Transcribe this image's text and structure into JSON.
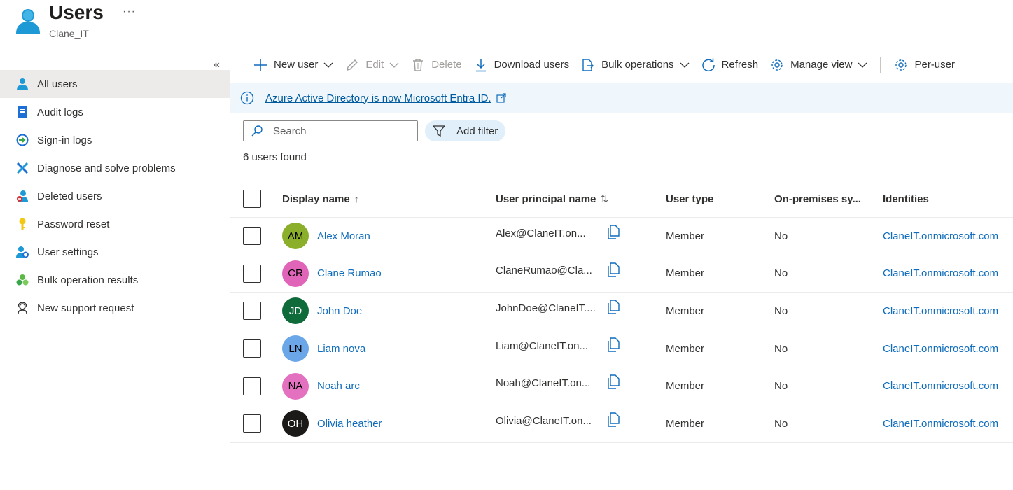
{
  "header": {
    "title": "Users",
    "subtitle": "Clane_IT",
    "more": "···"
  },
  "sidebar": {
    "collapse": "«",
    "items": [
      {
        "label": "All users",
        "icon": "user-icon",
        "active": true
      },
      {
        "label": "Audit logs",
        "icon": "audit-log-icon"
      },
      {
        "label": "Sign-in logs",
        "icon": "sign-in-icon"
      },
      {
        "label": "Diagnose and solve problems",
        "icon": "wrench-icon"
      },
      {
        "label": "Deleted users",
        "icon": "deleted-user-icon"
      },
      {
        "label": "Password reset",
        "icon": "key-icon"
      },
      {
        "label": "User settings",
        "icon": "user-settings-icon"
      },
      {
        "label": "Bulk operation results",
        "icon": "bulk-results-icon"
      },
      {
        "label": "New support request",
        "icon": "support-icon"
      }
    ]
  },
  "toolbar": {
    "new_user": "New user",
    "edit": "Edit",
    "delete": "Delete",
    "download": "Download users",
    "bulk": "Bulk operations",
    "refresh": "Refresh",
    "manage_view": "Manage view",
    "per_user": "Per-user"
  },
  "banner": {
    "text": "Azure Active Directory is now Microsoft Entra ID."
  },
  "search": {
    "placeholder": "Search"
  },
  "filter": {
    "label": "Add filter"
  },
  "count": "6 users found",
  "table": {
    "headers": {
      "display_name": "Display name",
      "display_name_sort": "↑",
      "upn": "User principal name",
      "upn_sort": "⇅",
      "user_type": "User type",
      "onprem": "On-premises sy...",
      "identities": "Identities"
    },
    "rows": [
      {
        "initials": "AM",
        "avatar_bg": "#8caf2b",
        "avatar_fg": "#000000",
        "name": "Alex Moran",
        "upn": "Alex@ClaneIT.on...",
        "type": "Member",
        "onprem": "No",
        "identity": "ClaneIT.onmicrosoft.com"
      },
      {
        "initials": "CR",
        "avatar_bg": "#e064b7",
        "avatar_fg": "#000000",
        "name": "Clane Rumao",
        "upn": "ClaneRumao@Cla...",
        "type": "Member",
        "onprem": "No",
        "identity": "ClaneIT.onmicrosoft.com"
      },
      {
        "initials": "JD",
        "avatar_bg": "#0f6b3a",
        "avatar_fg": "#ffffff",
        "name": "John Doe",
        "upn": "JohnDoe@ClaneIT....",
        "type": "Member",
        "onprem": "No",
        "identity": "ClaneIT.onmicrosoft.com"
      },
      {
        "initials": "LN",
        "avatar_bg": "#6ba7e8",
        "avatar_fg": "#000000",
        "name": "Liam nova",
        "upn": "Liam@ClaneIT.on...",
        "type": "Member",
        "onprem": "No",
        "identity": "ClaneIT.onmicrosoft.com"
      },
      {
        "initials": "NA",
        "avatar_bg": "#e371c0",
        "avatar_fg": "#000000",
        "name": "Noah arc",
        "upn": "Noah@ClaneIT.on...",
        "type": "Member",
        "onprem": "No",
        "identity": "ClaneIT.onmicrosoft.com"
      },
      {
        "initials": "OH",
        "avatar_bg": "#1b1a19",
        "avatar_fg": "#ffffff",
        "name": "Olivia heather",
        "upn": "Olivia@ClaneIT.on...",
        "type": "Member",
        "onprem": "No",
        "identity": "ClaneIT.onmicrosoft.com"
      }
    ]
  }
}
